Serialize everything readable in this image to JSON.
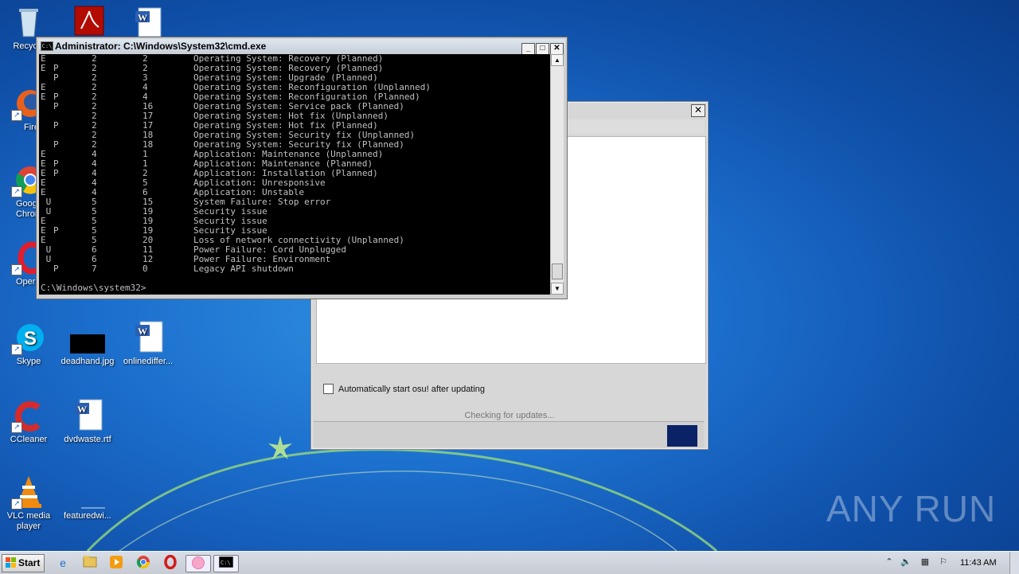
{
  "desktop": {
    "icons": [
      {
        "label": "Recycle",
        "icon": "recycle-bin-icon"
      },
      {
        "label": "",
        "icon": "acrobat-pdf-icon"
      },
      {
        "label": "",
        "icon": "word-doc-icon"
      },
      {
        "label": "Firefo",
        "icon": "firefox-icon"
      },
      {
        "label": "Googl\nChrom",
        "icon": "chrome-icon"
      },
      {
        "label": "Oper",
        "icon": "opera-icon"
      },
      {
        "label": "Skype",
        "icon": "skype-icon"
      },
      {
        "label": "deadhand.jpg",
        "icon": "image-file-icon"
      },
      {
        "label": "onlinediffer...",
        "icon": "word-doc-icon"
      },
      {
        "label": "CCleaner",
        "icon": "ccleaner-icon"
      },
      {
        "label": "dvdwaste.rtf",
        "icon": "word-doc-icon"
      },
      {
        "label": "VLC media\nplayer",
        "icon": "vlc-icon"
      },
      {
        "label": "featuredwi...",
        "icon": "blank-file-icon"
      }
    ],
    "watermark": "ANY RUN"
  },
  "cmd_window": {
    "title": "Administrator: C:\\Windows\\System32\\cmd.exe",
    "buttons": {
      "minimize": "_",
      "maximize": "□",
      "close": "✕"
    },
    "rows": [
      {
        "c1": "E",
        "c2": "",
        "c3": "2",
        "c4": "2",
        "c5": "Operating System: Recovery (Planned)"
      },
      {
        "c1": "E",
        "c2": "P",
        "c3": "2",
        "c4": "2",
        "c5": "Operating System: Recovery (Planned)"
      },
      {
        "c1": "",
        "c2": "P",
        "c3": "2",
        "c4": "3",
        "c5": "Operating System: Upgrade (Planned)"
      },
      {
        "c1": "E",
        "c2": "",
        "c3": "2",
        "c4": "4",
        "c5": "Operating System: Reconfiguration (Unplanned)"
      },
      {
        "c1": "E",
        "c2": "P",
        "c3": "2",
        "c4": "4",
        "c5": "Operating System: Reconfiguration (Planned)"
      },
      {
        "c1": "",
        "c2": "P",
        "c3": "2",
        "c4": "16",
        "c5": "Operating System: Service pack (Planned)"
      },
      {
        "c1": "",
        "c2": "",
        "c3": "2",
        "c4": "17",
        "c5": "Operating System: Hot fix (Unplanned)"
      },
      {
        "c1": "",
        "c2": "P",
        "c3": "2",
        "c4": "17",
        "c5": "Operating System: Hot fix (Planned)"
      },
      {
        "c1": "",
        "c2": "",
        "c3": "2",
        "c4": "18",
        "c5": "Operating System: Security fix (Unplanned)"
      },
      {
        "c1": "",
        "c2": "P",
        "c3": "2",
        "c4": "18",
        "c5": "Operating System: Security fix (Planned)"
      },
      {
        "c1": "E",
        "c2": "",
        "c3": "4",
        "c4": "1",
        "c5": "Application: Maintenance (Unplanned)"
      },
      {
        "c1": "E",
        "c2": "P",
        "c3": "4",
        "c4": "1",
        "c5": "Application: Maintenance (Planned)"
      },
      {
        "c1": "E",
        "c2": "P",
        "c3": "4",
        "c4": "2",
        "c5": "Application: Installation (Planned)"
      },
      {
        "c1": "E",
        "c2": "",
        "c3": "4",
        "c4": "5",
        "c5": "Application: Unresponsive"
      },
      {
        "c1": "E",
        "c2": "",
        "c3": "4",
        "c4": "6",
        "c5": "Application: Unstable"
      },
      {
        "c1": " U",
        "c2": "",
        "c3": "5",
        "c4": "15",
        "c5": "System Failure: Stop error"
      },
      {
        "c1": " U",
        "c2": "",
        "c3": "5",
        "c4": "19",
        "c5": "Security issue"
      },
      {
        "c1": "E",
        "c2": "",
        "c3": "5",
        "c4": "19",
        "c5": "Security issue"
      },
      {
        "c1": "E",
        "c2": "P",
        "c3": "5",
        "c4": "19",
        "c5": "Security issue"
      },
      {
        "c1": "E",
        "c2": "",
        "c3": "5",
        "c4": "20",
        "c5": "Loss of network connectivity (Unplanned)"
      },
      {
        "c1": " U",
        "c2": "",
        "c3": "6",
        "c4": "11",
        "c5": "Power Failure: Cord Unplugged"
      },
      {
        "c1": " U",
        "c2": "",
        "c3": "6",
        "c4": "12",
        "c5": "Power Failure: Environment"
      },
      {
        "c1": "",
        "c2": "P",
        "c3": "7",
        "c4": "0",
        "c5": "Legacy API shutdown"
      }
    ],
    "prompt": "C:\\Windows\\system32>"
  },
  "osu_window": {
    "close": "✕",
    "checkbox_label": "Automatically start osu! after updating",
    "checkbox_checked": false,
    "status": "Checking for updates..."
  },
  "taskbar": {
    "start_label": "Start",
    "apps": [
      "ie-icon",
      "explorer-folder-icon",
      "media-player-icon",
      "chrome-icon",
      "opera-icon",
      "osu-icon",
      "cmd-icon"
    ],
    "clock": "11:43 AM"
  },
  "colors": {
    "console_bg": "#000000",
    "console_fg": "#c0c0c0",
    "progress_block": "#0a2266"
  }
}
